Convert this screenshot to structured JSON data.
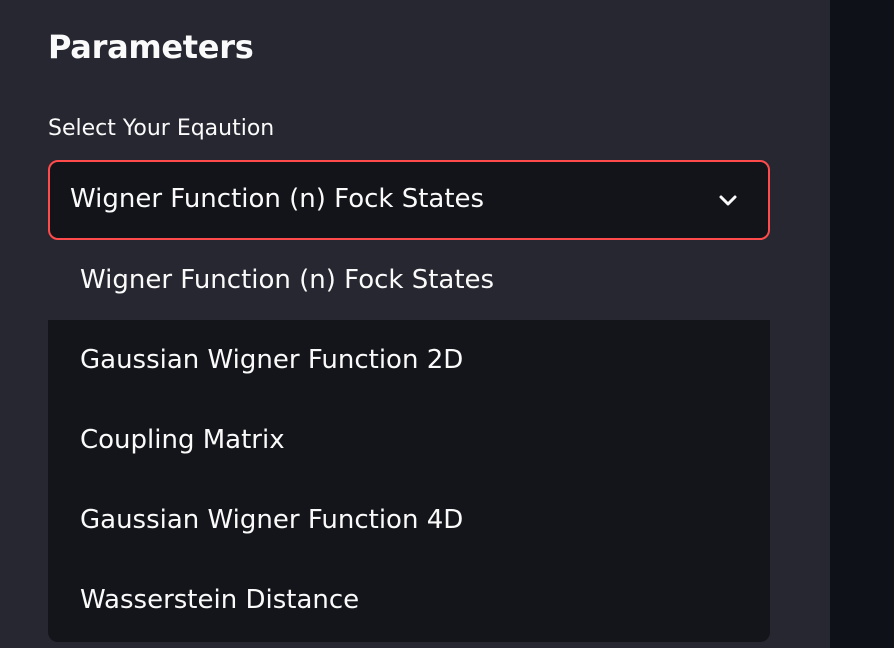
{
  "sidebar": {
    "title": "Parameters",
    "select_label": "Select Your Eqaution",
    "selected_value": "Wigner Function (n) Fock States",
    "options": [
      {
        "label": "Wigner Function (n) Fock States"
      },
      {
        "label": "Gaussian Wigner Function 2D"
      },
      {
        "label": "Coupling Matrix"
      },
      {
        "label": "Gaussian Wigner Function 4D"
      },
      {
        "label": "Wasserstein Distance"
      }
    ]
  },
  "colors": {
    "sidebar_bg": "#262730",
    "main_bg": "#0e1117",
    "focus_border": "#ff4b4b",
    "text": "#fafafa"
  },
  "icons": {
    "dropdown_toggle": "chevron-down-icon"
  }
}
